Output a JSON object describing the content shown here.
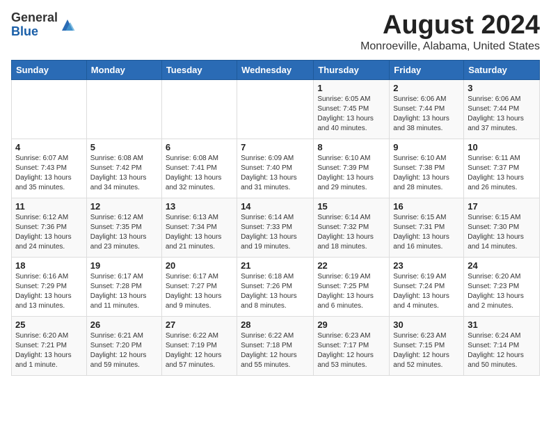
{
  "header": {
    "logo_line1": "General",
    "logo_line2": "Blue",
    "month_year": "August 2024",
    "location": "Monroeville, Alabama, United States"
  },
  "days_of_week": [
    "Sunday",
    "Monday",
    "Tuesday",
    "Wednesday",
    "Thursday",
    "Friday",
    "Saturday"
  ],
  "weeks": [
    [
      {
        "day": "",
        "info": ""
      },
      {
        "day": "",
        "info": ""
      },
      {
        "day": "",
        "info": ""
      },
      {
        "day": "",
        "info": ""
      },
      {
        "day": "1",
        "info": "Sunrise: 6:05 AM\nSunset: 7:45 PM\nDaylight: 13 hours\nand 40 minutes."
      },
      {
        "day": "2",
        "info": "Sunrise: 6:06 AM\nSunset: 7:44 PM\nDaylight: 13 hours\nand 38 minutes."
      },
      {
        "day": "3",
        "info": "Sunrise: 6:06 AM\nSunset: 7:44 PM\nDaylight: 13 hours\nand 37 minutes."
      }
    ],
    [
      {
        "day": "4",
        "info": "Sunrise: 6:07 AM\nSunset: 7:43 PM\nDaylight: 13 hours\nand 35 minutes."
      },
      {
        "day": "5",
        "info": "Sunrise: 6:08 AM\nSunset: 7:42 PM\nDaylight: 13 hours\nand 34 minutes."
      },
      {
        "day": "6",
        "info": "Sunrise: 6:08 AM\nSunset: 7:41 PM\nDaylight: 13 hours\nand 32 minutes."
      },
      {
        "day": "7",
        "info": "Sunrise: 6:09 AM\nSunset: 7:40 PM\nDaylight: 13 hours\nand 31 minutes."
      },
      {
        "day": "8",
        "info": "Sunrise: 6:10 AM\nSunset: 7:39 PM\nDaylight: 13 hours\nand 29 minutes."
      },
      {
        "day": "9",
        "info": "Sunrise: 6:10 AM\nSunset: 7:38 PM\nDaylight: 13 hours\nand 28 minutes."
      },
      {
        "day": "10",
        "info": "Sunrise: 6:11 AM\nSunset: 7:37 PM\nDaylight: 13 hours\nand 26 minutes."
      }
    ],
    [
      {
        "day": "11",
        "info": "Sunrise: 6:12 AM\nSunset: 7:36 PM\nDaylight: 13 hours\nand 24 minutes."
      },
      {
        "day": "12",
        "info": "Sunrise: 6:12 AM\nSunset: 7:35 PM\nDaylight: 13 hours\nand 23 minutes."
      },
      {
        "day": "13",
        "info": "Sunrise: 6:13 AM\nSunset: 7:34 PM\nDaylight: 13 hours\nand 21 minutes."
      },
      {
        "day": "14",
        "info": "Sunrise: 6:14 AM\nSunset: 7:33 PM\nDaylight: 13 hours\nand 19 minutes."
      },
      {
        "day": "15",
        "info": "Sunrise: 6:14 AM\nSunset: 7:32 PM\nDaylight: 13 hours\nand 18 minutes."
      },
      {
        "day": "16",
        "info": "Sunrise: 6:15 AM\nSunset: 7:31 PM\nDaylight: 13 hours\nand 16 minutes."
      },
      {
        "day": "17",
        "info": "Sunrise: 6:15 AM\nSunset: 7:30 PM\nDaylight: 13 hours\nand 14 minutes."
      }
    ],
    [
      {
        "day": "18",
        "info": "Sunrise: 6:16 AM\nSunset: 7:29 PM\nDaylight: 13 hours\nand 13 minutes."
      },
      {
        "day": "19",
        "info": "Sunrise: 6:17 AM\nSunset: 7:28 PM\nDaylight: 13 hours\nand 11 minutes."
      },
      {
        "day": "20",
        "info": "Sunrise: 6:17 AM\nSunset: 7:27 PM\nDaylight: 13 hours\nand 9 minutes."
      },
      {
        "day": "21",
        "info": "Sunrise: 6:18 AM\nSunset: 7:26 PM\nDaylight: 13 hours\nand 8 minutes."
      },
      {
        "day": "22",
        "info": "Sunrise: 6:19 AM\nSunset: 7:25 PM\nDaylight: 13 hours\nand 6 minutes."
      },
      {
        "day": "23",
        "info": "Sunrise: 6:19 AM\nSunset: 7:24 PM\nDaylight: 13 hours\nand 4 minutes."
      },
      {
        "day": "24",
        "info": "Sunrise: 6:20 AM\nSunset: 7:23 PM\nDaylight: 13 hours\nand 2 minutes."
      }
    ],
    [
      {
        "day": "25",
        "info": "Sunrise: 6:20 AM\nSunset: 7:21 PM\nDaylight: 13 hours\nand 1 minute."
      },
      {
        "day": "26",
        "info": "Sunrise: 6:21 AM\nSunset: 7:20 PM\nDaylight: 12 hours\nand 59 minutes."
      },
      {
        "day": "27",
        "info": "Sunrise: 6:22 AM\nSunset: 7:19 PM\nDaylight: 12 hours\nand 57 minutes."
      },
      {
        "day": "28",
        "info": "Sunrise: 6:22 AM\nSunset: 7:18 PM\nDaylight: 12 hours\nand 55 minutes."
      },
      {
        "day": "29",
        "info": "Sunrise: 6:23 AM\nSunset: 7:17 PM\nDaylight: 12 hours\nand 53 minutes."
      },
      {
        "day": "30",
        "info": "Sunrise: 6:23 AM\nSunset: 7:15 PM\nDaylight: 12 hours\nand 52 minutes."
      },
      {
        "day": "31",
        "info": "Sunrise: 6:24 AM\nSunset: 7:14 PM\nDaylight: 12 hours\nand 50 minutes."
      }
    ]
  ]
}
